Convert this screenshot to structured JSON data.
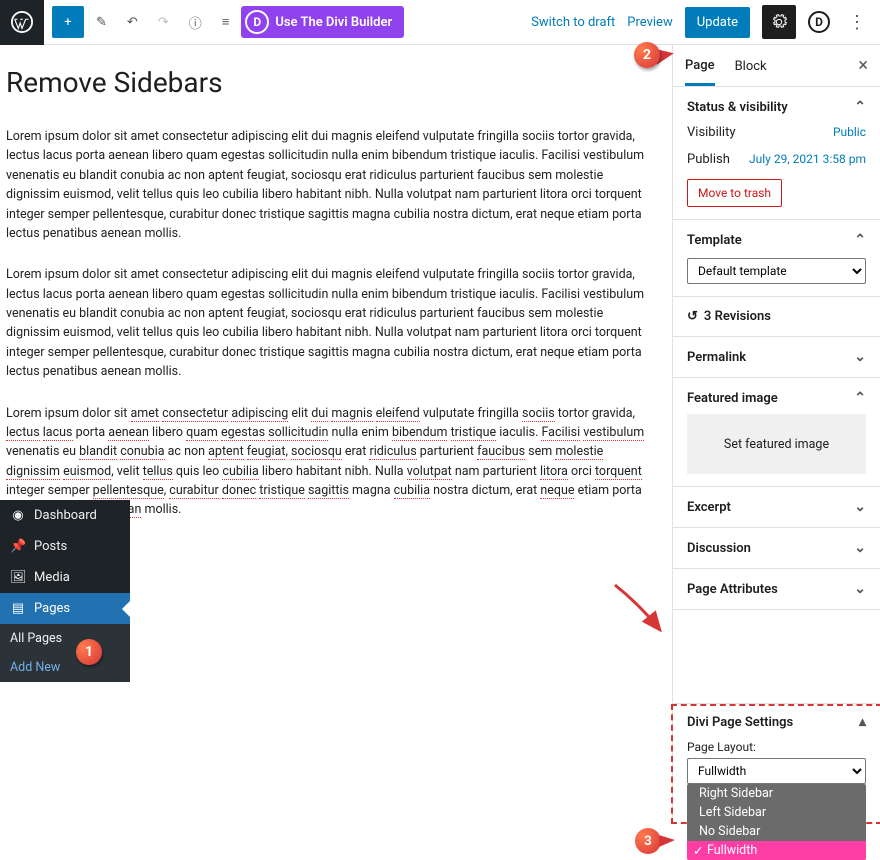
{
  "topbar": {
    "divi_button": "Use The Divi Builder",
    "switch_draft": "Switch to draft",
    "preview": "Preview",
    "update": "Update"
  },
  "editor": {
    "title": "Remove Sidebars",
    "p1": "Lorem ipsum dolor sit amet consectetur adipiscing elit dui magnis eleifend vulputate fringilla sociis tortor gravida, lectus lacus porta aenean libero quam egestas sollicitudin nulla enim bibendum tristique iaculis. Facilisi vestibulum venenatis eu blandit conubia ac non aptent feugiat, sociosqu erat ridiculus parturient faucibus sem molestie dignissim euismod, velit tellus quis leo cubilia libero habitant nibh. Nulla volutpat nam parturient litora orci torquent integer semper pellentesque, curabitur donec tristique sagittis magna cubilia nostra dictum, erat neque etiam porta lectus penatibus aenean mollis.",
    "p2": "Lorem ipsum dolor sit amet consectetur adipiscing elit dui magnis eleifend vulputate fringilla sociis tortor gravida, lectus lacus porta aenean libero quam egestas sollicitudin nulla enim bibendum tristique iaculis. Facilisi vestibulum venenatis eu blandit conubia ac non aptent feugiat, sociosqu erat ridiculus parturient faucibus sem molestie dignissim euismod, velit tellus quis leo cubilia libero habitant nibh. Nulla volutpat nam parturient litora orci torquent integer semper pellentesque, curabitur donec tristique sagittis magna cubilia nostra dictum, erat neque etiam porta lectus penatibus aenean mollis."
  },
  "adminmenu": {
    "dashboard": "Dashboard",
    "posts": "Posts",
    "media": "Media",
    "pages": "Pages",
    "all_pages": "All Pages",
    "add_new": "Add New"
  },
  "sidebar": {
    "tab_page": "Page",
    "tab_block": "Block",
    "status": {
      "heading": "Status & visibility",
      "visibility_label": "Visibility",
      "visibility_value": "Public",
      "publish_label": "Publish",
      "publish_value": "July 29, 2021 3:58 pm",
      "trash": "Move to trash"
    },
    "template": {
      "heading": "Template",
      "value": "Default template"
    },
    "revisions": {
      "text": "3 Revisions"
    },
    "permalink": "Permalink",
    "featured": {
      "heading": "Featured image",
      "placeholder": "Set featured image"
    },
    "excerpt": "Excerpt",
    "discussion": "Discussion",
    "attributes": "Page Attributes",
    "divi": {
      "heading": "Divi Page Settings",
      "layout_label": "Page Layout:",
      "selected": "Fullwidth",
      "options": [
        "Right Sidebar",
        "Left Sidebar",
        "No Sidebar",
        "Fullwidth"
      ]
    }
  },
  "callouts": {
    "c1": "1",
    "c2": "2",
    "c3": "3"
  }
}
